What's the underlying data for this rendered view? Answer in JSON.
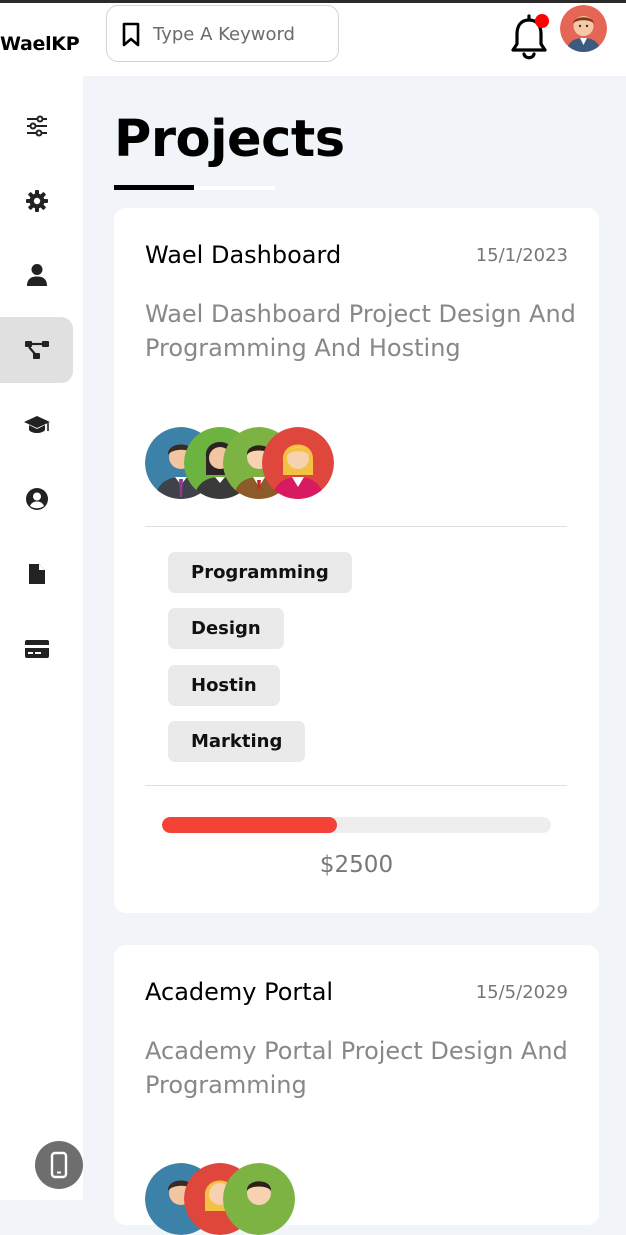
{
  "header": {
    "brand": "WaelKP",
    "search_placeholder": "Type A Keyword",
    "notification_dot_color": "#ff0000"
  },
  "sidebar": {
    "items": [
      {
        "name": "sliders",
        "icon": "sliders-icon"
      },
      {
        "name": "settings",
        "icon": "gear-icon"
      },
      {
        "name": "profile",
        "icon": "user-icon"
      },
      {
        "name": "projects",
        "icon": "project-diagram-icon",
        "active": true
      },
      {
        "name": "courses",
        "icon": "graduation-cap-icon"
      },
      {
        "name": "friends",
        "icon": "user-circle-icon"
      },
      {
        "name": "files",
        "icon": "file-icon"
      },
      {
        "name": "plans",
        "icon": "credit-card-icon"
      }
    ],
    "mobile_button_icon": "mobile-icon"
  },
  "main": {
    "page_title": "Projects",
    "projects": [
      {
        "title": "Wael Dashboard",
        "date": "15/1/2023",
        "description": "Wael Dashboard Project Design And Programming And Hosting",
        "tags": [
          "Programming",
          "Design",
          "Hostin",
          "Markting"
        ],
        "progress": 0.45,
        "progress_color": "#f44336",
        "price": "$2500"
      },
      {
        "title": "Academy Portal",
        "date": "15/5/2029",
        "description": "Academy Portal Project Design And Programming"
      }
    ]
  }
}
